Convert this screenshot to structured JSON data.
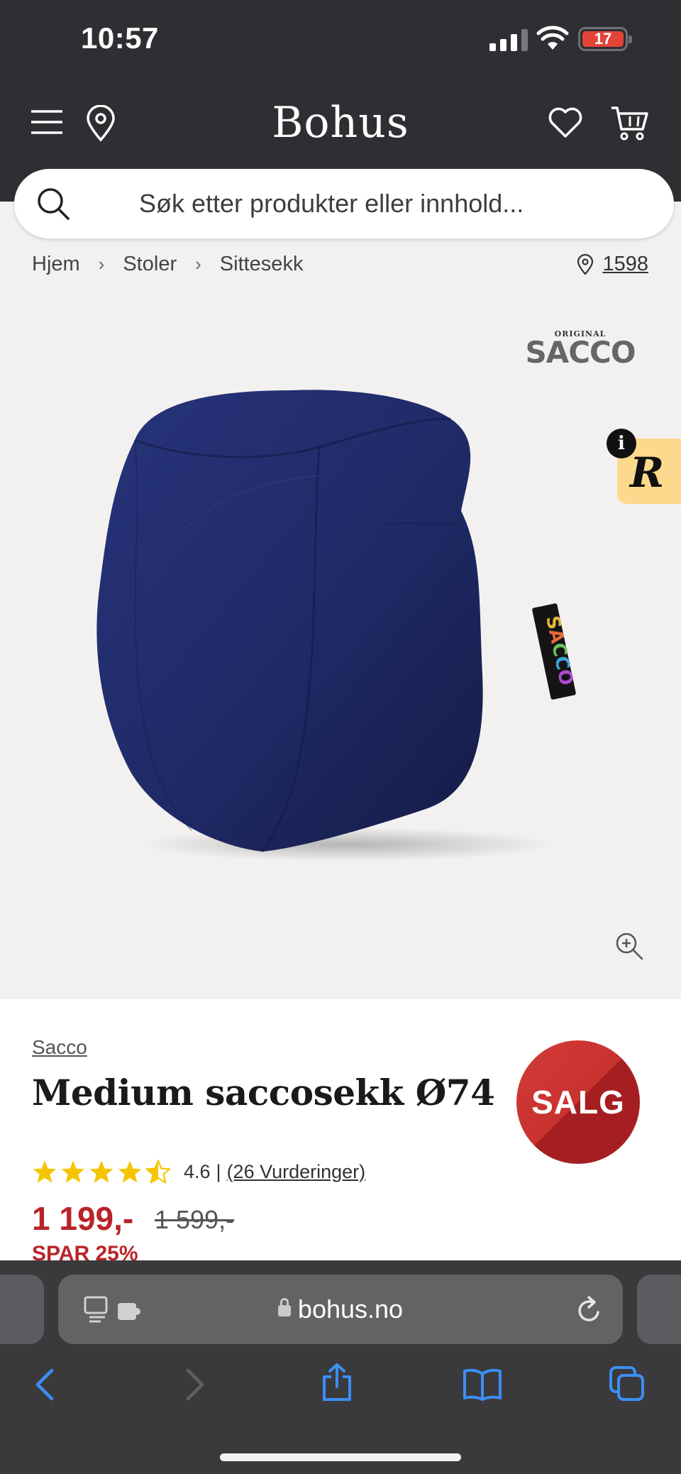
{
  "status_bar": {
    "time": "10:57",
    "battery": "17"
  },
  "header": {
    "logo": "Bohus",
    "search_placeholder": "Søk etter produkter eller innhold..."
  },
  "breadcrumb": {
    "items": [
      "Hjem",
      "Stoler",
      "Sittesekk"
    ],
    "store_number": "1598"
  },
  "product_image": {
    "brand_logo_small": "ORIGINAL",
    "brand_logo_big": "SACCO",
    "badge_letter": "R",
    "info_letter": "i",
    "colors": {
      "fabric": "#1f2a66",
      "badge_bg": "#fcd98c"
    }
  },
  "product": {
    "brand": "Sacco",
    "title": "Medium saccosekk Ø74",
    "sale_badge": "SALG",
    "rating_value": "4.6",
    "rating_stars": 4.6,
    "rating_separator": "|",
    "reviews_link": "(26 Vurderinger)",
    "price": "1 199,-",
    "old_price": "1 599,-",
    "savings": "SPAR 25%",
    "colors": {
      "price": "#b8242a",
      "star": "#f6c500"
    }
  },
  "browser": {
    "url": "bohus.no"
  }
}
